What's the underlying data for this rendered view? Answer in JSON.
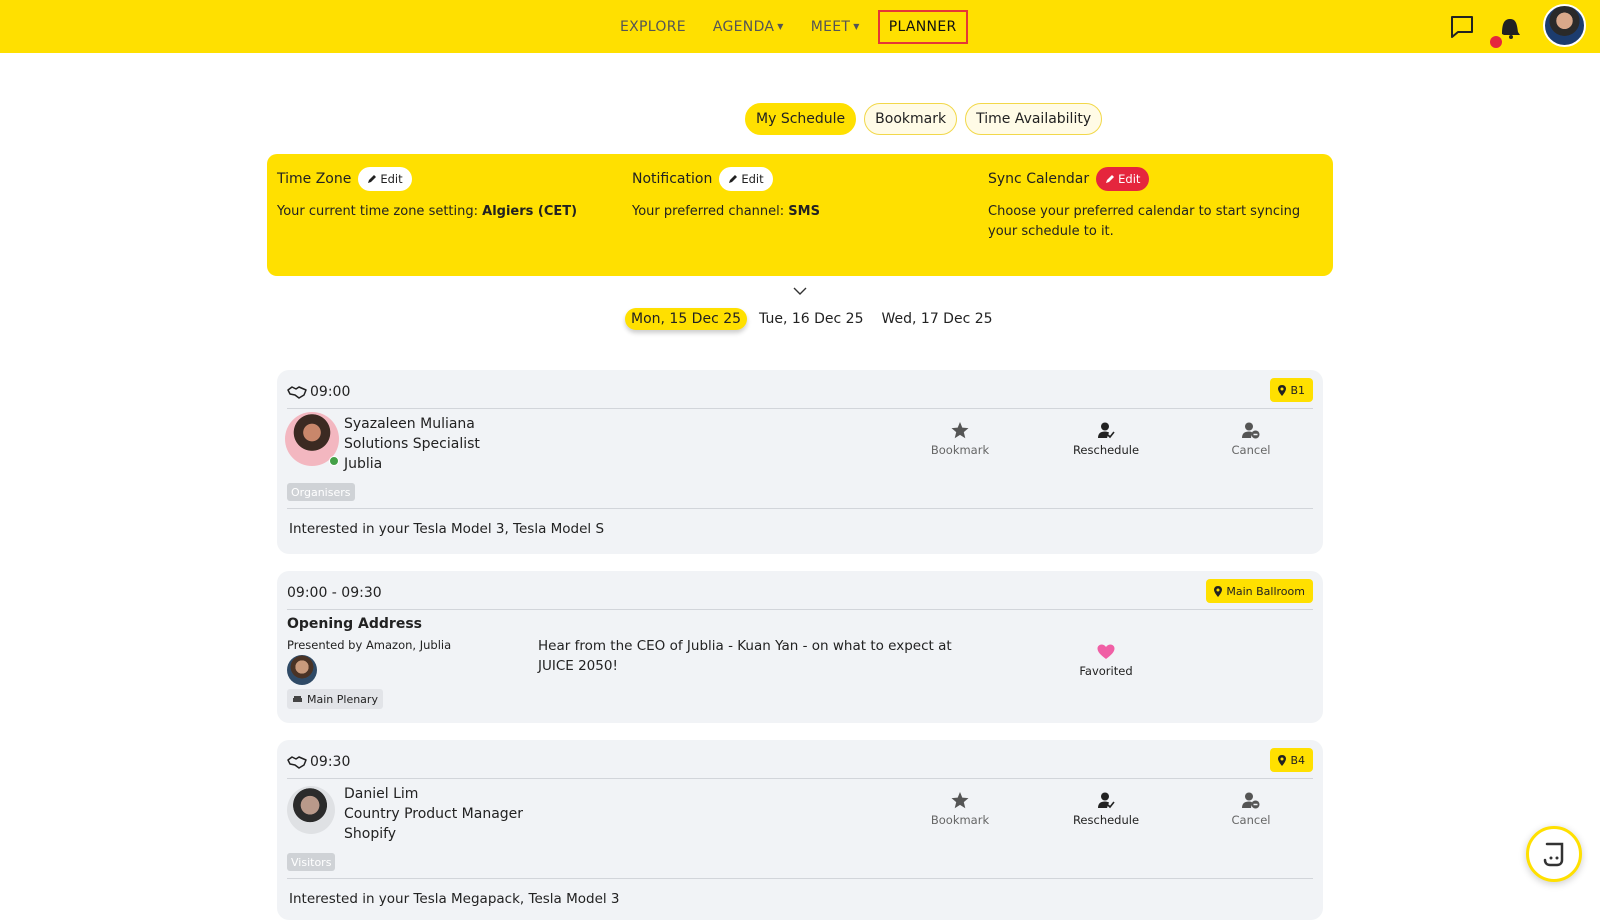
{
  "nav": {
    "items": [
      {
        "label": "EXPLORE",
        "dropdown": false
      },
      {
        "label": "AGENDA",
        "dropdown": true
      },
      {
        "label": "MEET",
        "dropdown": true
      },
      {
        "label": "PLANNER",
        "dropdown": false,
        "active": true
      }
    ],
    "icons": [
      "chat-icon",
      "bell-icon",
      "avatar"
    ]
  },
  "tabs": [
    "My Schedule",
    "Bookmark",
    "Time Availability"
  ],
  "settings": {
    "timezone": {
      "title": "Time Zone",
      "edit": "Edit",
      "prefix": "Your current time zone setting: ",
      "value": "Algiers (CET)"
    },
    "notification": {
      "title": "Notification",
      "edit": "Edit",
      "prefix": "Your preferred channel: ",
      "value": "SMS"
    },
    "sync": {
      "title": "Sync Calendar",
      "edit": "Edit",
      "text": "Choose your preferred calendar to start syncing your schedule to it."
    }
  },
  "dates": [
    "Mon, 15 Dec 25",
    "Tue, 16 Dec 25",
    "Wed, 17 Dec 25"
  ],
  "cards": {
    "m1": {
      "time": "09:00",
      "location": "B1",
      "name": "Syazaleen Muliana",
      "title": "Solutions Specialist",
      "company": "Jublia",
      "tag": "Organisers",
      "actions": {
        "bookmark": "Bookmark",
        "reschedule": "Reschedule",
        "cancel": "Cancel"
      },
      "note": "Interested in your Tesla Model 3, Tesla Model S"
    },
    "session": {
      "time": "09:00 - 09:30",
      "location": "Main Ballroom",
      "title": "Opening Address",
      "presented": "Presented by Amazon, Jublia",
      "room": "Main Plenary",
      "desc": "Hear from the CEO of Jublia - Kuan Yan - on what to expect at JUICE 2050!",
      "fav": "Favorited"
    },
    "m2": {
      "time": "09:30",
      "location": "B4",
      "name": "Daniel Lim",
      "title": "Country Product Manager",
      "company": "Shopify",
      "tag": "Visitors",
      "actions": {
        "bookmark": "Bookmark",
        "reschedule": "Reschedule",
        "cancel": "Cancel"
      },
      "note": "Interested in your Tesla Megapack, Tesla Model 3"
    }
  },
  "colors": {
    "accent": "#FFE000",
    "danger": "#E5263D",
    "card": "#F1F3F6"
  }
}
